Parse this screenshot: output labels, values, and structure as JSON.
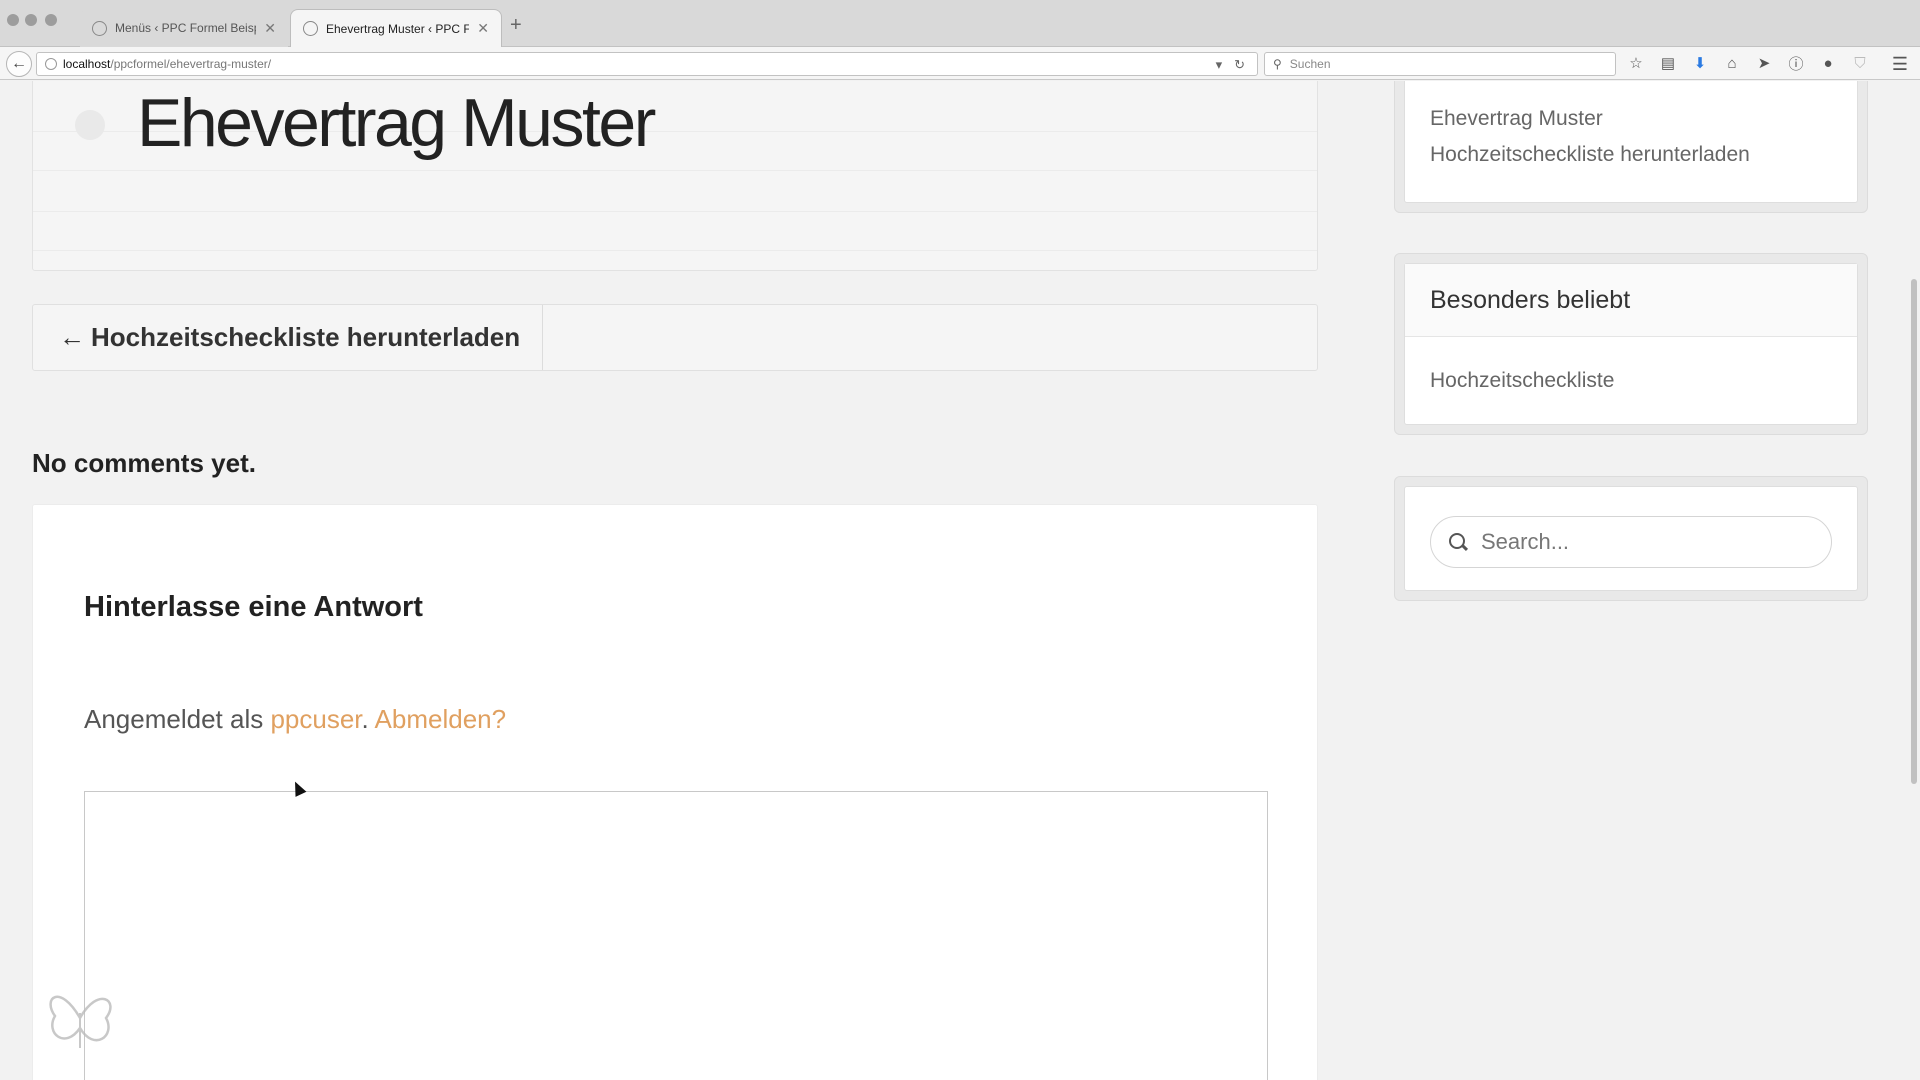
{
  "browser": {
    "tabs": [
      {
        "label": "Menüs ‹ PPC Formel Beispi…",
        "active": false
      },
      {
        "label": "Ehevertrag Muster ‹ PPC Fo…",
        "active": true
      }
    ],
    "url_host": "localhost",
    "url_path": "/ppcformel/ehevertrag-muster/",
    "search_placeholder": "Suchen"
  },
  "post": {
    "title": "Ehevertrag Muster",
    "prev_arrow": "←",
    "prev_link": "Hochzeitscheckliste herunterladen"
  },
  "comments": {
    "none_text": "No comments yet.",
    "reply_title": "Hinterlasse eine Antwort",
    "logged_in_prefix": "Angemeldet als ",
    "username": "ppcuser",
    "separator": ". ",
    "logout": "Abmelden?"
  },
  "sidebar": {
    "recent_items": [
      "Ehevertrag Muster",
      "Hochzeitscheckliste herunterladen"
    ],
    "popular_title": "Besonders beliebt",
    "popular_items": [
      "Hochzeitscheckliste"
    ],
    "search_placeholder": "Search..."
  },
  "colors": {
    "accent": "#e0a060",
    "page_bg": "#f2f2f2"
  },
  "icons": [
    "globe-icon",
    "close-icon",
    "plus-icon",
    "back-arrow-icon",
    "reload-icon",
    "search-icon",
    "star-icon",
    "reading-list-icon",
    "download-icon",
    "home-icon",
    "send-icon",
    "info-icon",
    "chat-icon",
    "shield-icon",
    "hamburger-menu-icon",
    "butterfly-logo-icon"
  ]
}
